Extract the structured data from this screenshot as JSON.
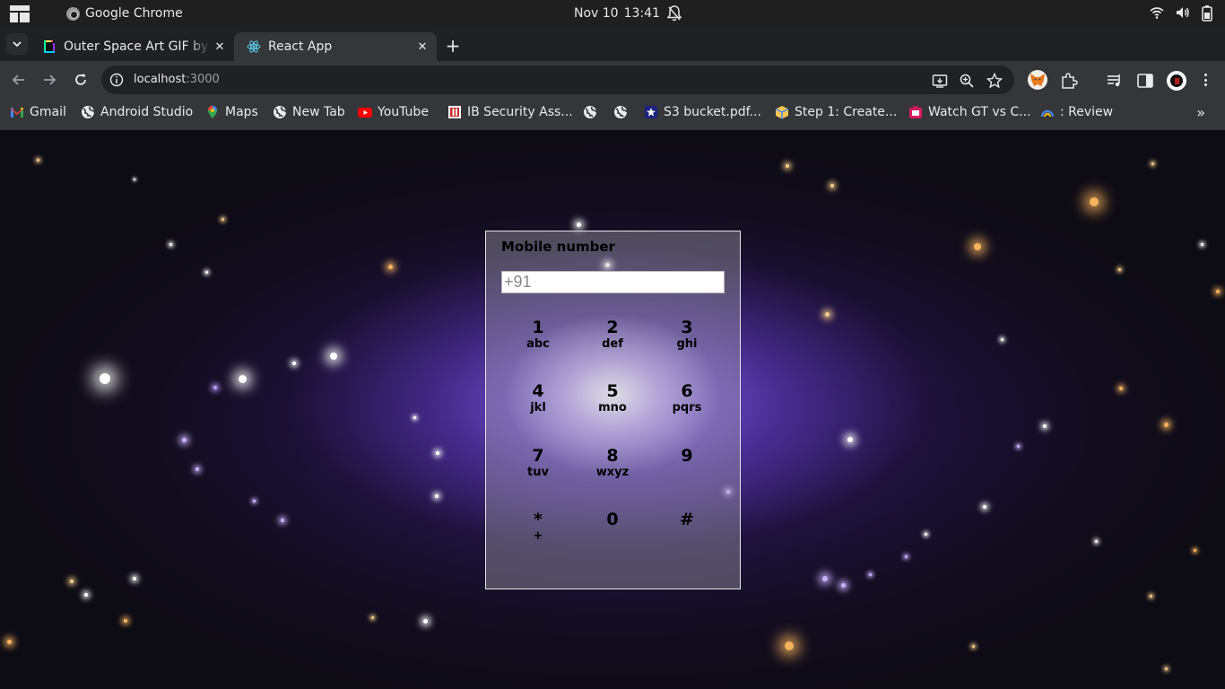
{
  "os_bar": {
    "app_name": "Google Chrome",
    "date": "Nov 10",
    "time": "13:41"
  },
  "tabs": [
    {
      "title": "Outer Space Art GIF by xponentialdesign",
      "active": false
    },
    {
      "title": "React App",
      "active": true
    }
  ],
  "toolbar": {
    "url_host": "localhost",
    "url_port": ":3000"
  },
  "bookmarks": [
    {
      "label": "Gmail",
      "icon": "gmail-icon"
    },
    {
      "label": "Android Studio",
      "icon": "globe-icon"
    },
    {
      "label": "Maps",
      "icon": "maps-icon"
    },
    {
      "label": "New Tab",
      "icon": "globe-icon"
    },
    {
      "label": "YouTube",
      "icon": "youtube-icon"
    },
    {
      "label": "IB Security Ass...",
      "icon": "ib-icon"
    },
    {
      "label": "",
      "icon": "globe-icon"
    },
    {
      "label": "",
      "icon": "globe-icon"
    },
    {
      "label": "S3 bucket.pdf...",
      "icon": "star-doc-icon"
    },
    {
      "label": "Step 1: Create...",
      "icon": "box-icon"
    },
    {
      "label": "Watch GT vs C...",
      "icon": "tv-icon"
    },
    {
      "label": ": Review",
      "icon": "review-icon"
    }
  ],
  "dialer": {
    "label": "Mobile number",
    "input_value": "",
    "input_placeholder": "+91",
    "keys": [
      {
        "digit": "1",
        "letters": "abc"
      },
      {
        "digit": "2",
        "letters": "def"
      },
      {
        "digit": "3",
        "letters": "ghi"
      },
      {
        "digit": "4",
        "letters": "jkl"
      },
      {
        "digit": "5",
        "letters": "mno"
      },
      {
        "digit": "6",
        "letters": "pqrs"
      },
      {
        "digit": "7",
        "letters": "tuv"
      },
      {
        "digit": "8",
        "letters": "wxyz"
      },
      {
        "digit": "9",
        "letters": ""
      },
      {
        "digit": "*",
        "letters": "+"
      },
      {
        "digit": "0",
        "letters": ""
      },
      {
        "digit": "#",
        "letters": ""
      }
    ]
  },
  "colors": {
    "os_bar": "#1f1f1f",
    "tabstrip": "#202124",
    "toolbar": "#35363a",
    "omnibox": "#202124",
    "text_light": "#e8eaed",
    "galaxy_purple": "#8a6cff"
  }
}
